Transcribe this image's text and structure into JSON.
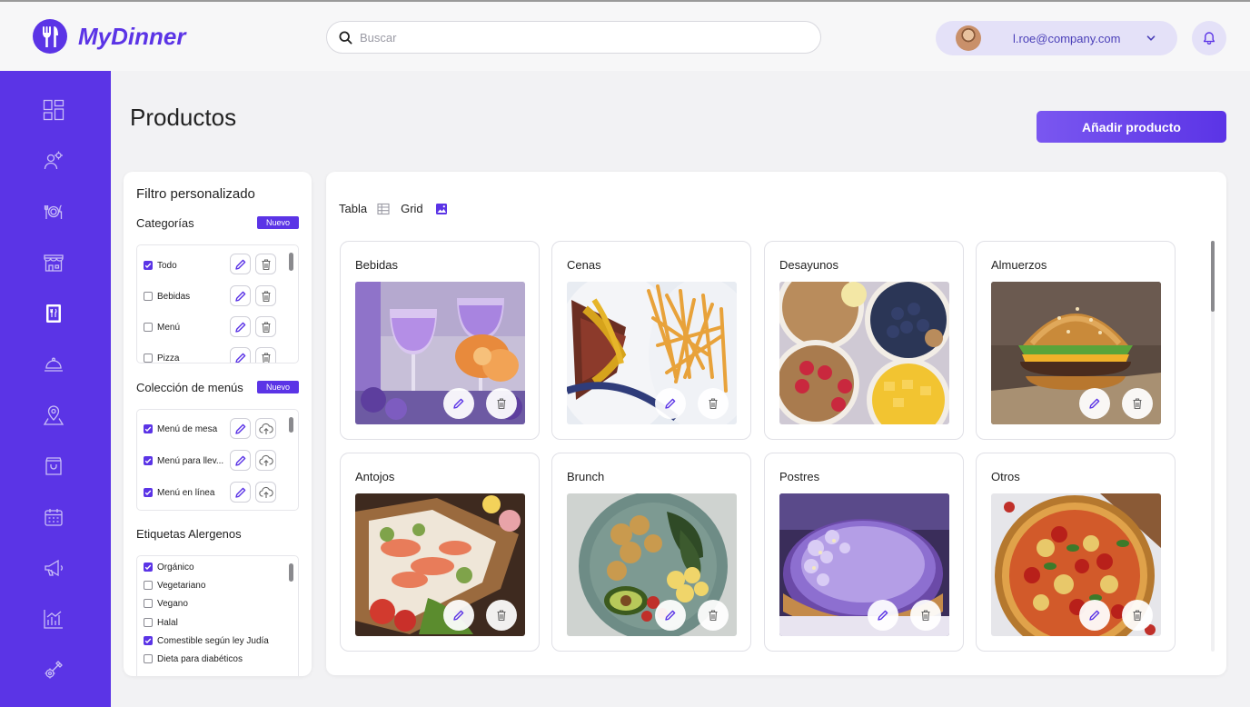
{
  "app": {
    "name": "MyDinner",
    "logo_icon": "fork-knife-icon",
    "brand_color": "#5b34e6"
  },
  "search": {
    "placeholder": "Buscar",
    "value": ""
  },
  "user": {
    "email": "l.roe@company.com"
  },
  "sidebar": {
    "items": [
      {
        "icon": "dashboard-icon"
      },
      {
        "icon": "users-settings-icon"
      },
      {
        "icon": "dining-icon"
      },
      {
        "icon": "store-icon"
      },
      {
        "icon": "menu-book-icon",
        "active": true
      },
      {
        "icon": "cloche-icon"
      },
      {
        "icon": "location-icon"
      },
      {
        "icon": "bag-icon"
      },
      {
        "icon": "calendar-icon"
      },
      {
        "icon": "megaphone-icon"
      },
      {
        "icon": "bar-chart-icon"
      },
      {
        "icon": "tools-icon"
      }
    ]
  },
  "page": {
    "title": "Productos",
    "add_label": "Añadir producto"
  },
  "filter": {
    "title": "Filtro personalizado",
    "categories": {
      "label": "Categorías",
      "badge": "Nuevo",
      "items": [
        {
          "label": "Todo",
          "checked": true
        },
        {
          "label": "Bebidas",
          "checked": false
        },
        {
          "label": "Menú",
          "checked": false
        },
        {
          "label": "Pizza",
          "checked": false
        }
      ]
    },
    "collections": {
      "label": "Colección de menús",
      "badge": "Nuevo",
      "items": [
        {
          "label": "Menú de mesa",
          "checked": true
        },
        {
          "label": "Menú para llev...",
          "checked": true
        },
        {
          "label": "Menú en línea",
          "checked": true
        }
      ]
    },
    "allergens": {
      "label": "Etiquetas Alergenos",
      "items": [
        {
          "label": "Orgánico",
          "checked": true
        },
        {
          "label": "Vegetariano",
          "checked": false
        },
        {
          "label": "Vegano",
          "checked": false
        },
        {
          "label": "Halal",
          "checked": false
        },
        {
          "label": "Comestible según ley Judía",
          "checked": true
        },
        {
          "label": "Dieta para diabéticos",
          "checked": false
        }
      ]
    }
  },
  "view": {
    "table_label": "Tabla",
    "grid_label": "Grid",
    "active": "Grid"
  },
  "products": [
    {
      "title": "Bebidas"
    },
    {
      "title": "Cenas"
    },
    {
      "title": "Desayunos"
    },
    {
      "title": "Almuerzos"
    },
    {
      "title": "Antojos"
    },
    {
      "title": "Brunch"
    },
    {
      "title": "Postres"
    },
    {
      "title": "Otros"
    }
  ]
}
